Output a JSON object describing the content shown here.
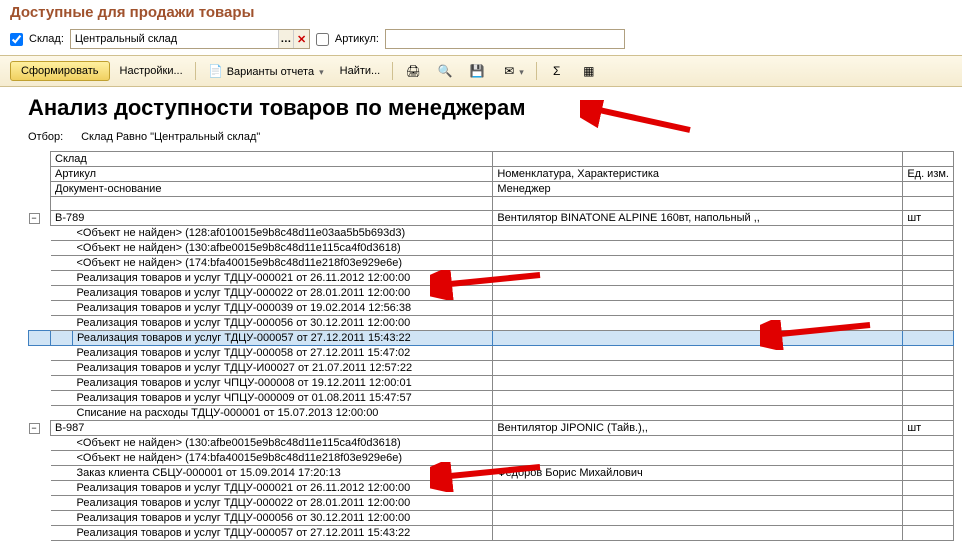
{
  "window_title": "Доступные для продажи товары",
  "filters": {
    "sklad_label": "Склад:",
    "sklad_value": "Центральный склад",
    "artikul_label": "Артикул:",
    "artikul_value": ""
  },
  "toolbar": {
    "form": "Сформировать",
    "settings": "Настройки...",
    "variants": "Варианты отчета",
    "find": "Найти..."
  },
  "report": {
    "title": "Анализ доступности товаров по менеджерам",
    "filter_label": "Отбор:",
    "filter_text": "Склад Равно \"Центральный склад\""
  },
  "headers": {
    "sklad": "Склад",
    "artikul": "Артикул",
    "nom": "Номенклатура, Характеристика",
    "unit": "Ед. изм.",
    "doc": "Документ-основание",
    "manager": "Менеджер"
  },
  "group1": {
    "code": "В-789",
    "nom": "Вентилятор BINATONE ALPINE 160вт, напольный ,,",
    "unit": "шт",
    "rows": [
      {
        "doc": "   <Объект не найден> (128:af010015e9b8c48d11e03aa5b5b693d3)",
        "mgr": ""
      },
      {
        "doc": "   <Объект не найден> (130:afbe0015e9b8c48d11e115ca4f0d3618)",
        "mgr": ""
      },
      {
        "doc": "   <Объект не найден> (174:bfa40015e9b8c48d11e218f03e929e6e)",
        "mgr": ""
      },
      {
        "doc": "   Реализация товаров и услуг ТДЦУ-000021 от 26.11.2012 12:00:00",
        "mgr": ""
      },
      {
        "doc": "   Реализация товаров и услуг ТДЦУ-000022 от 28.01.2011 12:00:00",
        "mgr": ""
      },
      {
        "doc": "   Реализация товаров и услуг ТДЦУ-000039 от 19.02.2014 12:56:38",
        "mgr": ""
      },
      {
        "doc": "   Реализация товаров и услуг ТДЦУ-000056 от 30.12.2011 12:00:00",
        "mgr": ""
      },
      {
        "doc": "   Реализация товаров и услуг ТДЦУ-000057 от 27.12.2011 15:43:22",
        "mgr": "",
        "selected": true
      },
      {
        "doc": "   Реализация товаров и услуг ТДЦУ-000058 от 27.12.2011 15:47:02",
        "mgr": ""
      },
      {
        "doc": "   Реализация товаров и услуг ТДЦУ-И00027 от 21.07.2011 12:57:22",
        "mgr": ""
      },
      {
        "doc": "   Реализация товаров и услуг ЧПЦУ-000008 от 19.12.2011 12:00:01",
        "mgr": ""
      },
      {
        "doc": "   Реализация товаров и услуг ЧПЦУ-000009 от 01.08.2011 15:47:57",
        "mgr": ""
      },
      {
        "doc": "   Списание на расходы ТДЦУ-000001 от 15.07.2013 12:00:00",
        "mgr": ""
      }
    ]
  },
  "group2": {
    "code": "В-987",
    "nom": "Вентилятор JIPONIC (Тайв.),,",
    "unit": "шт",
    "rows": [
      {
        "doc": "   <Объект не найден> (130:afbe0015e9b8c48d11e115ca4f0d3618)",
        "mgr": ""
      },
      {
        "doc": "   <Объект не найден> (174:bfa40015e9b8c48d11e218f03e929e6e)",
        "mgr": ""
      },
      {
        "doc": "   Заказ клиента СБЦУ-000001 от 15.09.2014 17:20:13",
        "mgr": "Федоров Борис Михайлович"
      },
      {
        "doc": "   Реализация товаров и услуг ТДЦУ-000021 от 26.11.2012 12:00:00",
        "mgr": ""
      },
      {
        "doc": "   Реализация товаров и услуг ТДЦУ-000022 от 28.01.2011 12:00:00",
        "mgr": ""
      },
      {
        "doc": "   Реализация товаров и услуг ТДЦУ-000056 от 30.12.2011 12:00:00",
        "mgr": ""
      },
      {
        "doc": "   Реализация товаров и услуг ТДЦУ-000057 от 27.12.2011 15:43:22",
        "mgr": ""
      }
    ]
  }
}
